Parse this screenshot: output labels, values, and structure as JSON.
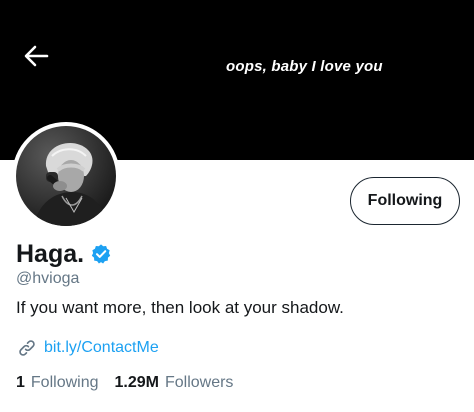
{
  "header": {
    "banner_text": "oops, baby I love you",
    "back_icon": "arrow-left-icon"
  },
  "profile": {
    "display_name": "Haga.",
    "verified_icon": "verified-badge-icon",
    "handle": "@hvioga",
    "bio": "If you want more, then look at your shadow.",
    "link_icon": "link-icon",
    "link": "bit.ly/ContactMe",
    "follow_button": "Following"
  },
  "stats": {
    "following_count": "1",
    "following_label": "Following",
    "followers_count": "1.29M",
    "followers_label": "Followers"
  },
  "colors": {
    "banner": "#000000",
    "accent": "#1da1f2",
    "text": "#14171a",
    "secondary": "#657786"
  }
}
